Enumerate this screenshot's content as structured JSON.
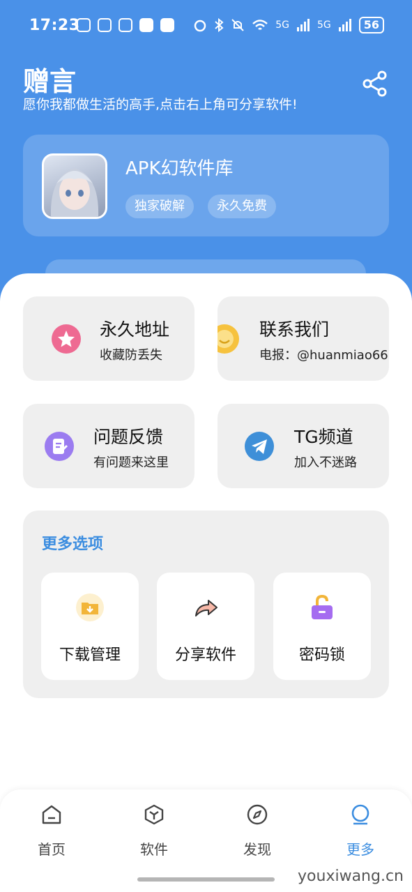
{
  "status_bar": {
    "time": "17:23",
    "battery": "56",
    "net1": "5G",
    "net2": "5G"
  },
  "header": {
    "title": "赠言",
    "subtitle": "愿你我都做生活的高手,点击右上角可分享软件!"
  },
  "profile": {
    "name": "APK幻软件库",
    "tags": [
      "独家破解",
      "永久免费"
    ]
  },
  "tiles": [
    {
      "title": "永久地址",
      "subtitle": "收藏防丢失",
      "icon": "star-icon",
      "color": "#ee6a92"
    },
    {
      "title": "联系我们",
      "subtitle": "电报：@huanmiao66",
      "icon": "smile-icon",
      "color": "#f6c23e"
    },
    {
      "title": "问题反馈",
      "subtitle": "有问题来这里",
      "icon": "feedback-icon",
      "color": "#9b7cf0"
    },
    {
      "title": "TG频道",
      "subtitle": "加入不迷路",
      "icon": "telegram-icon",
      "color": "#3e8fd8"
    }
  ],
  "more": {
    "title": "更多选项",
    "options": [
      {
        "label": "下载管理",
        "icon": "folder-download-icon"
      },
      {
        "label": "分享软件",
        "icon": "share-arrow-icon"
      },
      {
        "label": "密码锁",
        "icon": "unlock-icon"
      }
    ]
  },
  "nav": [
    {
      "label": "首页",
      "icon": "home-icon",
      "active": false
    },
    {
      "label": "软件",
      "icon": "cube-icon",
      "active": false
    },
    {
      "label": "发现",
      "icon": "compass-icon",
      "active": false
    },
    {
      "label": "更多",
      "icon": "circle-icon",
      "active": true
    }
  ],
  "accent_color": "#4a91e8",
  "watermark": "youxiwang.cn"
}
